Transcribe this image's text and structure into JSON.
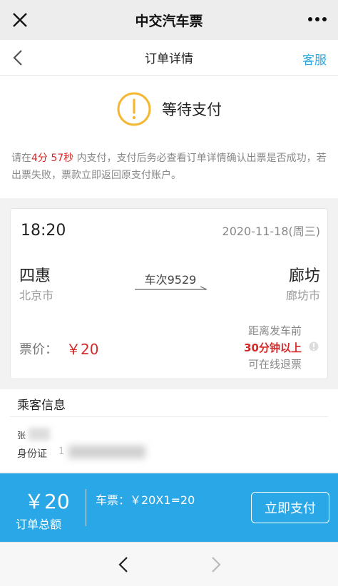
{
  "wechat": {
    "title": "中交汽车票",
    "close_icon": "close-icon",
    "more_icon": "more-dots-icon"
  },
  "nav": {
    "title": "订单详情",
    "service_label": "客服",
    "back_icon": "chevron-left-icon"
  },
  "status": {
    "text": "等待支付",
    "icon": "warning-circle-icon",
    "notice_prefix": "请在",
    "notice_time": "4分 57秒",
    "notice_suffix": " 内支付，支付后务必查看订单详情确认出票是否成功，若出票失败，票款立即返回原支付账户。"
  },
  "ticket": {
    "departure_time": "18:20",
    "date": "2020-11-18(周三)",
    "from_station": "四惠",
    "from_city": "北京市",
    "to_station": "廊坊",
    "to_city": "廊坊市",
    "train_no": "车次9529",
    "price_label": "票价：",
    "price": "￥20",
    "refund_line1": "距离发车前",
    "refund_line2": "30分钟以上",
    "refund_line3": "可在线退票"
  },
  "passenger": {
    "title": "乘客信息",
    "name_partial": "张",
    "id_label": "身份证",
    "id_partial": "1"
  },
  "payment": {
    "total_amount": "￥20",
    "total_label": "订单总额",
    "fare_detail": "车票：￥20X1=20",
    "pay_button": "立即支付"
  },
  "colors": {
    "accent": "#2aa7e6",
    "warning": "#f5b731",
    "highlight_red": "#d42a2a"
  }
}
